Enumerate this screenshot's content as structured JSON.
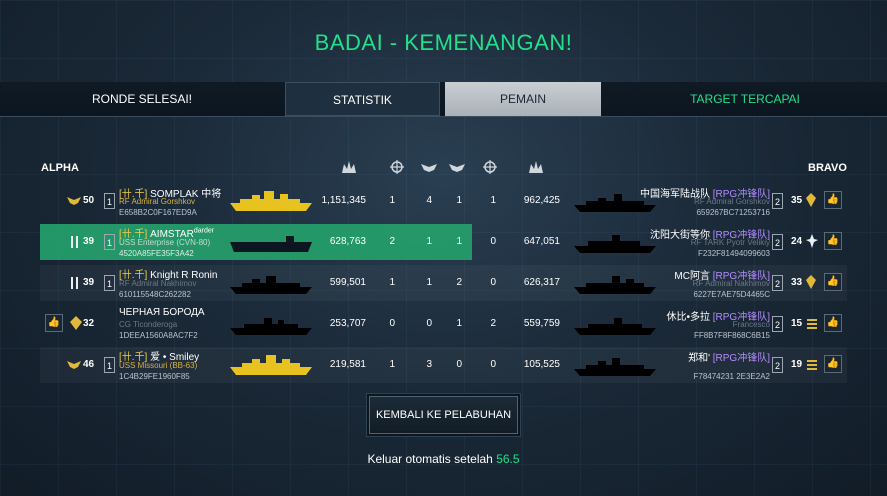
{
  "title": "BADAI - KEMENANGAN!",
  "topbar": {
    "left": "RONDE SELESAI!",
    "tab_stats": "STATISTIK",
    "tab_players": "PEMAIN",
    "right": "TARGET TERCAPAI"
  },
  "teams": {
    "left": "ALPHA",
    "right": "BRAVO"
  },
  "header_icons": [
    "damage-icon",
    "crosshair-icon",
    "wings-icon",
    "wings-icon",
    "crosshair-icon",
    "damage-icon"
  ],
  "rows": [
    {
      "left_level": "50",
      "left_rank": "1",
      "left_tag": "[卄.千]",
      "left_name": " SOMPLAK 中将",
      "left_name_sup": "",
      "left_ship": "RF Admiral Gorshkov",
      "left_hash": "E658B2C0F167ED9A",
      "left_ship_color": "yellow",
      "left_score": "1,151,345",
      "s1": "1",
      "s2": "4",
      "s3": "1",
      "s4": "1",
      "right_score": "962,425",
      "right_name": "中国海军陆战队 ",
      "right_tag": "[RPG冲锋队]",
      "right_ship": "RF Admiral Gorshkov",
      "right_hash": "659267BC71253716",
      "right_rank": "2",
      "right_level": "35"
    },
    {
      "left_level": "39",
      "left_rank": "1",
      "left_tag": "[卄.千]",
      "left_name": " AIMSTAR",
      "left_name_sup": "darder",
      "left_ship": "USS Enterprise (CVN-80)",
      "left_hash": "4520A85FE35F3A42",
      "left_ship_color": "dim",
      "left_score": "628,763",
      "s1": "2",
      "s2": "1",
      "s3": "1",
      "s4": "0",
      "right_score": "647,051",
      "right_name": "沈阳大街等你 ",
      "right_tag": "[RPG冲锋队]",
      "right_ship": "RF TARK Pyotr Velikiy",
      "right_hash": "F232F81494099603",
      "right_rank": "2",
      "right_level": "24"
    },
    {
      "left_level": "39",
      "left_rank": "1",
      "left_tag": "[卄.千]",
      "left_name": " Knight R Ronin",
      "left_name_sup": "",
      "left_ship": "RF Admiral Nakhimov",
      "left_hash": "610115548C262282",
      "left_ship_color": "dim",
      "left_score": "599,501",
      "s1": "1",
      "s2": "1",
      "s3": "2",
      "s4": "0",
      "right_score": "626,317",
      "right_name": "MC阿言 ",
      "right_tag": "[RPG冲锋队]",
      "right_ship": "RF Admiral Nakhimov",
      "right_hash": "6227E7AE75D4465C",
      "right_rank": "2",
      "right_level": "33"
    },
    {
      "left_level": "32",
      "left_rank": "",
      "left_tag": "",
      "left_name": "ЧЕРНАЯ БОРОДА",
      "left_name_sup": "",
      "left_ship": "CG Ticonderoga",
      "left_hash": "1DEEA1560A8AC7F2",
      "left_ship_color": "dim",
      "left_score": "253,707",
      "s1": "0",
      "s2": "0",
      "s3": "1",
      "s4": "2",
      "right_score": "559,759",
      "right_name": "休比•多拉 ",
      "right_tag": "[RPG冲锋队]",
      "right_ship": "Francesco",
      "right_hash": "FF8B7F8F868C6B15",
      "right_rank": "2",
      "right_level": "15"
    },
    {
      "left_level": "46",
      "left_rank": "1",
      "left_tag": "[卄.千]",
      "left_name": " 爱 • Smiley",
      "left_name_sup": "",
      "left_ship": "USS Missouri (BB-63)",
      "left_hash": "1C4B29FE1960F85",
      "left_ship_color": "yellow",
      "left_score": "219,581",
      "s1": "1",
      "s2": "3",
      "s3": "0",
      "s4": "0",
      "right_score": "105,525",
      "right_name": "郑和' ",
      "right_tag": "[RPG冲锋队]",
      "right_ship": "",
      "right_hash": "F78474231 2E3E2A2",
      "right_rank": "2",
      "right_level": "19"
    }
  ],
  "home_button": "KEMBALI KE PELABUHAN",
  "auto_exit": {
    "text": "Keluar otomatis setelah ",
    "count": "56.5"
  },
  "colors": {
    "accent": "#21e08a",
    "highlight_row": "#25a06b",
    "gold": "#f0d04b",
    "purple": "#b38cff"
  }
}
